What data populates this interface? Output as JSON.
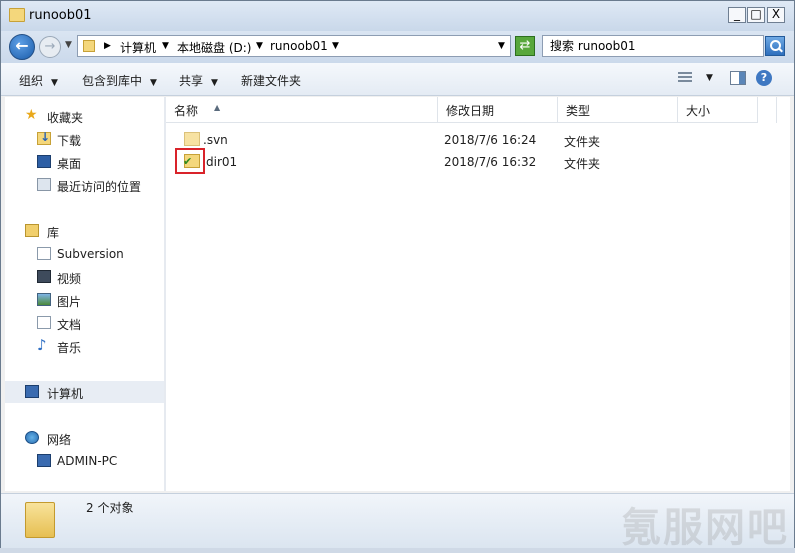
{
  "window": {
    "title": "runoob01",
    "controls": {
      "minimize": "_",
      "maximize": "□",
      "close": "X"
    }
  },
  "address": {
    "breadcrumbs": [
      "计算机",
      "本地磁盘 (D:)",
      "runoob01"
    ],
    "search_placeholder": "搜索 runoob01"
  },
  "toolbar": {
    "organize": "组织",
    "include_library": "包含到库中",
    "share": "共享",
    "new_folder": "新建文件夹"
  },
  "nav": {
    "favorites": {
      "label": "收藏夹",
      "items": [
        "下载",
        "桌面",
        "最近访问的位置"
      ]
    },
    "libraries": {
      "label": "库",
      "items": [
        "Subversion",
        "视频",
        "图片",
        "文档",
        "音乐"
      ]
    },
    "computer": {
      "label": "计算机"
    },
    "network": {
      "label": "网络",
      "items": [
        "ADMIN-PC"
      ]
    }
  },
  "columns": {
    "name": "名称",
    "date": "修改日期",
    "type": "类型",
    "size": "大小"
  },
  "files": [
    {
      "name": ".svn",
      "date": "2018/7/6 16:24",
      "type": "文件夹",
      "icon": "svn-folder-icon"
    },
    {
      "name": "dir01",
      "date": "2018/7/6 16:32",
      "type": "文件夹",
      "icon": "versioned-folder-icon"
    }
  ],
  "status": {
    "count": "2 个对象"
  },
  "watermark": "氪服网吧"
}
